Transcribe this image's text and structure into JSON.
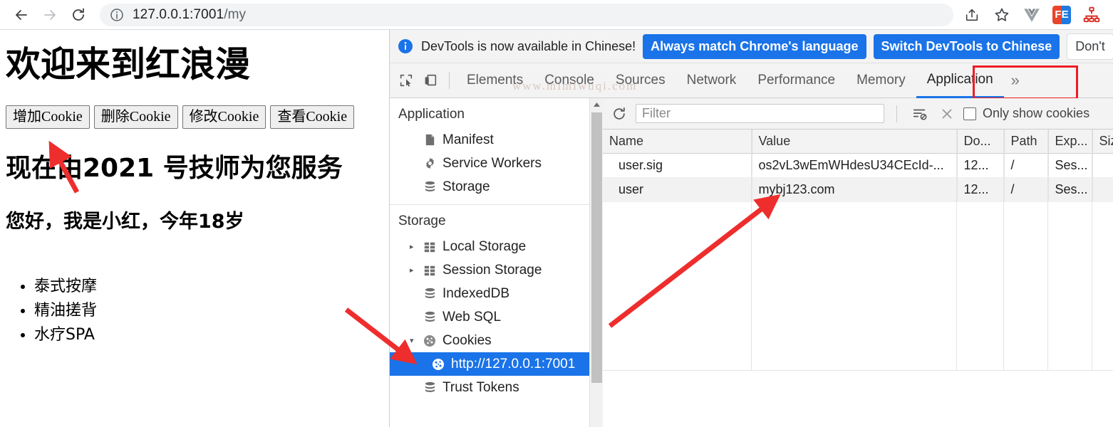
{
  "browser": {
    "back_label": "Back",
    "forward_label": "Forward",
    "reload_label": "Reload",
    "url_main": "127.0.0.1:7001",
    "url_path": "/my",
    "share_label": "Share",
    "bookmark_label": "Bookmark this tab",
    "extensions": [
      {
        "name": "vue-devtools-icon",
        "text": "V",
        "color": "#8a8a8a"
      },
      {
        "name": "fe-extension-icon",
        "text": "FE",
        "color": "#e8452c"
      },
      {
        "name": "sitemap-extension-icon",
        "text": "",
        "color": "#d93025"
      }
    ]
  },
  "page": {
    "heading": "欢迎来到红浪漫",
    "buttons": [
      {
        "label": "增加Cookie"
      },
      {
        "label": "删除Cookie"
      },
      {
        "label": "修改Cookie"
      },
      {
        "label": "查看Cookie"
      }
    ],
    "subheading": "现在由2021 号技师为您服务",
    "greeting": "您好，我是小红，今年18岁",
    "services": [
      "泰式按摩",
      "精油搓背",
      "水疗SPA"
    ]
  },
  "devtools": {
    "notice": {
      "message": "DevTools is now available in Chinese!",
      "primary_button": "Always match Chrome's language",
      "secondary_button": "Switch DevTools to Chinese",
      "tertiary_button": "Don't"
    },
    "watermark": "www.mimiwuqi.com",
    "tabs": [
      {
        "label": "Elements",
        "active": false
      },
      {
        "label": "Console",
        "active": false
      },
      {
        "label": "Sources",
        "active": false
      },
      {
        "label": "Network",
        "active": false
      },
      {
        "label": "Performance",
        "active": false
      },
      {
        "label": "Memory",
        "active": false
      },
      {
        "label": "Application",
        "active": true
      }
    ],
    "more_tabs_label": "»",
    "sidebar": {
      "application_title": "Application",
      "application_items": [
        {
          "label": "Manifest",
          "icon": "document-icon"
        },
        {
          "label": "Service Workers",
          "icon": "gear-icon"
        },
        {
          "label": "Storage",
          "icon": "database-icon"
        }
      ],
      "storage_title": "Storage",
      "storage_items": [
        {
          "label": "Local Storage",
          "icon": "table-icon",
          "arrow": "collapsed",
          "indent": 1
        },
        {
          "label": "Session Storage",
          "icon": "table-icon",
          "arrow": "collapsed",
          "indent": 1
        },
        {
          "label": "IndexedDB",
          "icon": "database-icon",
          "arrow": "none",
          "indent": 1
        },
        {
          "label": "Web SQL",
          "icon": "database-icon",
          "arrow": "none",
          "indent": 1
        },
        {
          "label": "Cookies",
          "icon": "cookie-icon",
          "arrow": "expanded",
          "indent": 1
        },
        {
          "label": "http://127.0.0.1:7001",
          "icon": "cookie-icon",
          "arrow": "none",
          "indent": 2,
          "selected": true
        },
        {
          "label": "Trust Tokens",
          "icon": "database-icon",
          "arrow": "none",
          "indent": 1
        }
      ]
    },
    "cookie_toolbar": {
      "refresh_label": "Refresh",
      "filter_placeholder": "Filter",
      "clear_filtered_label": "Clear filtered cookies",
      "clear_all_label": "Clear all cookies",
      "only_show_label": "Only show cookies"
    },
    "cookie_table": {
      "columns": [
        "Name",
        "Value",
        "Do...",
        "Path",
        "Exp...",
        "Siz"
      ],
      "rows": [
        {
          "name": "user.sig",
          "value": "os2vL3wEmWHdesU34CEcId-...",
          "domain": "12...",
          "path": "/",
          "expires": "Ses...",
          "size": ""
        },
        {
          "name": "user",
          "value": "mybj123.com",
          "domain": "12...",
          "path": "/",
          "expires": "Ses...",
          "size": ""
        }
      ]
    }
  },
  "annotations": {
    "arrow_color": "#ee2d2d",
    "box_color": "#ee1c25",
    "arrows": [
      {
        "name": "arrow-to-add-cookie-button"
      },
      {
        "name": "arrow-to-cookies-tree-item"
      },
      {
        "name": "arrow-to-cookie-value"
      }
    ]
  }
}
